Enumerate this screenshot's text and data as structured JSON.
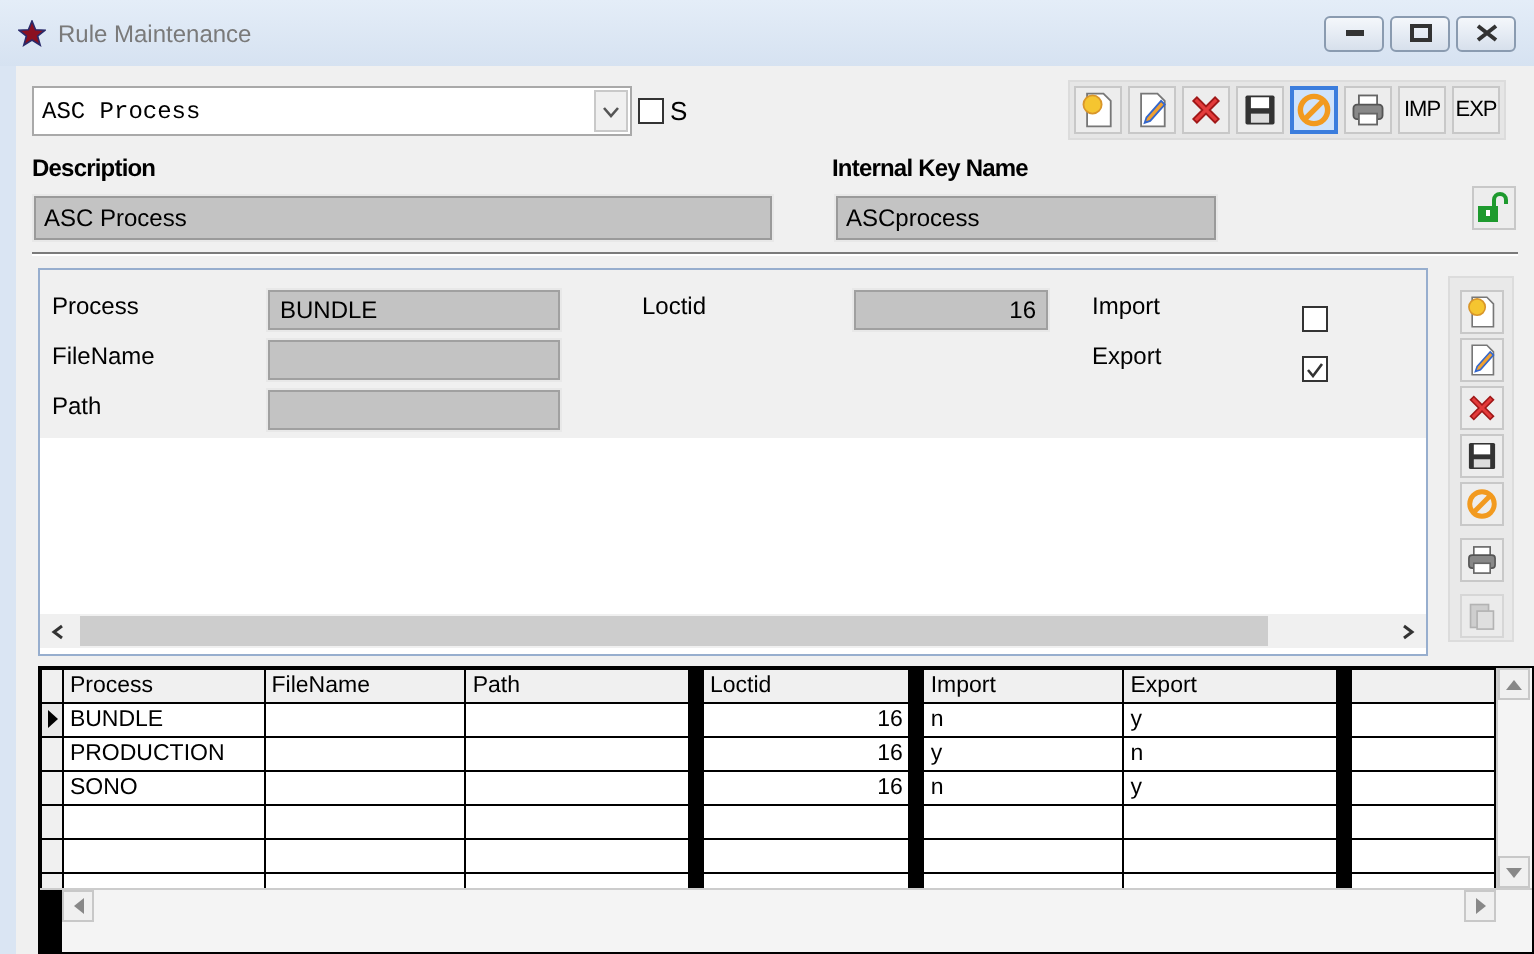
{
  "window": {
    "title": "Rule Maintenance"
  },
  "selector": {
    "value": "ASC Process",
    "checkbox": {
      "label": "S",
      "checked": false
    }
  },
  "toolbar": [
    {
      "kind": "new",
      "selected": false
    },
    {
      "kind": "edit",
      "selected": false
    },
    {
      "kind": "delete",
      "selected": false
    },
    {
      "kind": "save",
      "selected": false
    },
    {
      "kind": "cancel",
      "selected": true
    },
    {
      "kind": "print",
      "selected": false
    },
    {
      "kind": "text",
      "label": "IMP",
      "selected": false
    },
    {
      "kind": "text",
      "label": "EXP",
      "selected": false
    }
  ],
  "description": {
    "label": "Description",
    "value": "ASC Process"
  },
  "internal_key": {
    "label": "Internal Key Name",
    "value": "ASCprocess",
    "locked": false
  },
  "detail": {
    "columns": [
      [
        {
          "kind": "text",
          "label": "Process",
          "value": "BUNDLE"
        },
        {
          "kind": "text",
          "label": "FileName"
        },
        {
          "kind": "text",
          "label": "Path"
        }
      ],
      [
        {
          "kind": "number",
          "label": "Loctid",
          "value": "16"
        }
      ],
      [
        {
          "kind": "checkbox",
          "label": "Import",
          "checked": false
        },
        {
          "kind": "checkbox",
          "label": "Export",
          "checked": true
        }
      ]
    ]
  },
  "side_toolbar": [
    {
      "kind": "new",
      "disabled": false
    },
    {
      "kind": "edit",
      "disabled": false
    },
    {
      "kind": "delete",
      "disabled": false
    },
    {
      "kind": "save",
      "disabled": false
    },
    {
      "kind": "cancel",
      "disabled": false
    },
    {
      "kind": "print",
      "disabled": false
    },
    {
      "kind": "paste",
      "disabled": true
    }
  ],
  "grid": {
    "columns": [
      {
        "label": "Process",
        "kind": "text"
      },
      {
        "label": "FileName",
        "kind": "text"
      },
      {
        "label": "Path",
        "kind": "text"
      },
      {
        "label": "Loctid",
        "kind": "number"
      },
      {
        "label": "Import",
        "kind": "text"
      },
      {
        "label": "Export",
        "kind": "text"
      }
    ],
    "rows": [
      {
        "selected": true,
        "cells": [
          "BUNDLE",
          null,
          null,
          "16",
          "n",
          "y"
        ]
      },
      {
        "selected": false,
        "cells": [
          "PRODUCTION",
          null,
          null,
          "16",
          "y",
          "n"
        ]
      },
      {
        "selected": false,
        "cells": [
          "SONO",
          null,
          null,
          "16",
          "n",
          "y"
        ]
      }
    ]
  }
}
